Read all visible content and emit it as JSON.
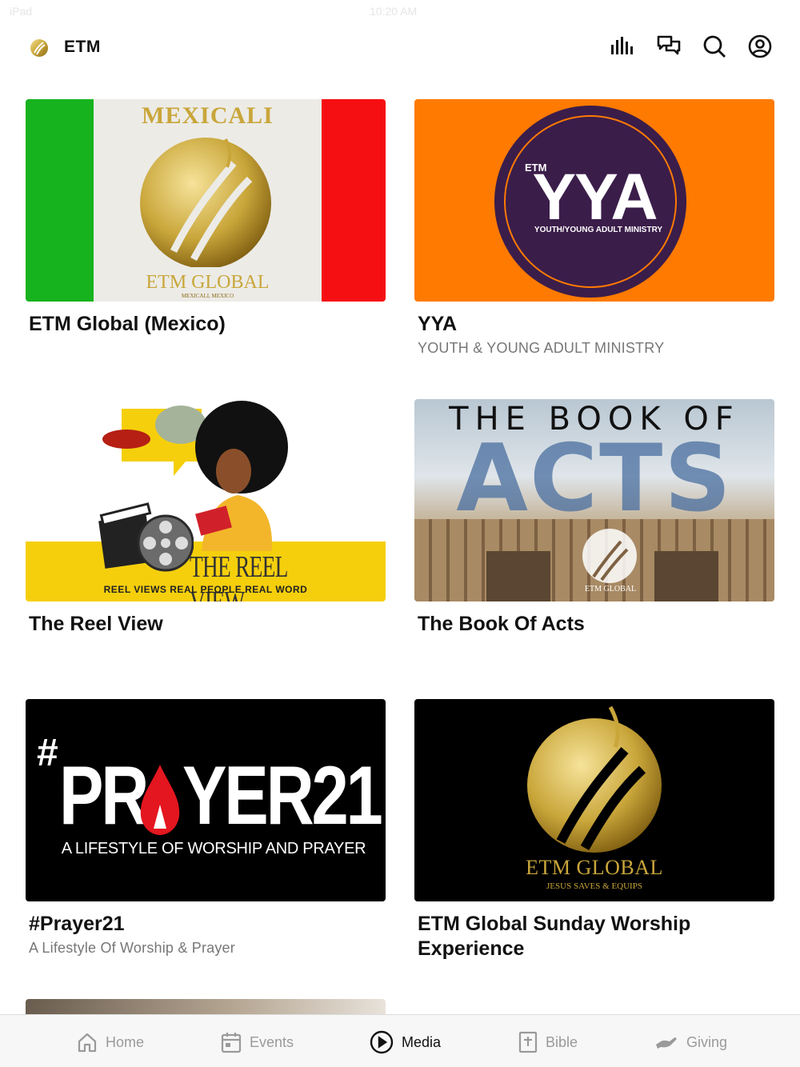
{
  "status": {
    "left": "iPad",
    "time": "10:20 AM"
  },
  "header": {
    "title": "ETM",
    "icons": [
      "audio-bars-icon",
      "chat-bubbles-icon",
      "search-icon",
      "account-icon"
    ]
  },
  "colors": {
    "gold": "#c9a63a",
    "orange": "#ff7a00",
    "purple": "#3b1d4a",
    "yellow": "#f5cf0c",
    "accent": "#111111"
  },
  "cards": [
    {
      "title": "ETM Global (Mexico)",
      "subtitle": "",
      "thumb": {
        "line1": "MEXICALI",
        "line2": "ETM GLOBAL",
        "line3": "MEXICALI, MEXICO"
      }
    },
    {
      "title": "YYA",
      "subtitle": "YOUTH & YOUNG ADULT MINISTRY",
      "thumb": {
        "line1": "ETM",
        "line2": "YYA",
        "line3": "YOUTH/YOUNG ADULT MINISTRY"
      }
    },
    {
      "title": "The Reel View",
      "subtitle": "",
      "thumb": {
        "line1": "THE REEL VIEW",
        "line2": "REEL VIEWS REAL PEOPLE REAL WORD"
      }
    },
    {
      "title": "The Book Of Acts",
      "subtitle": "",
      "thumb": {
        "line1": "THE BOOK OF",
        "line2": "ACTS",
        "line3": "ETM GLOBAL"
      }
    },
    {
      "title": "#Prayer21",
      "subtitle": "A Lifestyle Of Worship & Prayer",
      "thumb": {
        "line1": "#",
        "line2": "PR",
        "line3": "YER21",
        "line4": "A LIFESTYLE OF WORSHIP AND PRAYER"
      }
    },
    {
      "title": "ETM Global Sunday Worship Experience",
      "subtitle": "",
      "thumb": {
        "line1": "ETM GLOBAL",
        "line2": "JESUS SAVES & EQUIPS"
      }
    }
  ],
  "tabs": [
    {
      "label": "Home",
      "icon": "home-icon",
      "active": false
    },
    {
      "label": "Events",
      "icon": "calendar-icon",
      "active": false
    },
    {
      "label": "Media",
      "icon": "play-circle-icon",
      "active": true
    },
    {
      "label": "Bible",
      "icon": "bible-icon",
      "active": false
    },
    {
      "label": "Giving",
      "icon": "giving-hand-icon",
      "active": false
    }
  ]
}
